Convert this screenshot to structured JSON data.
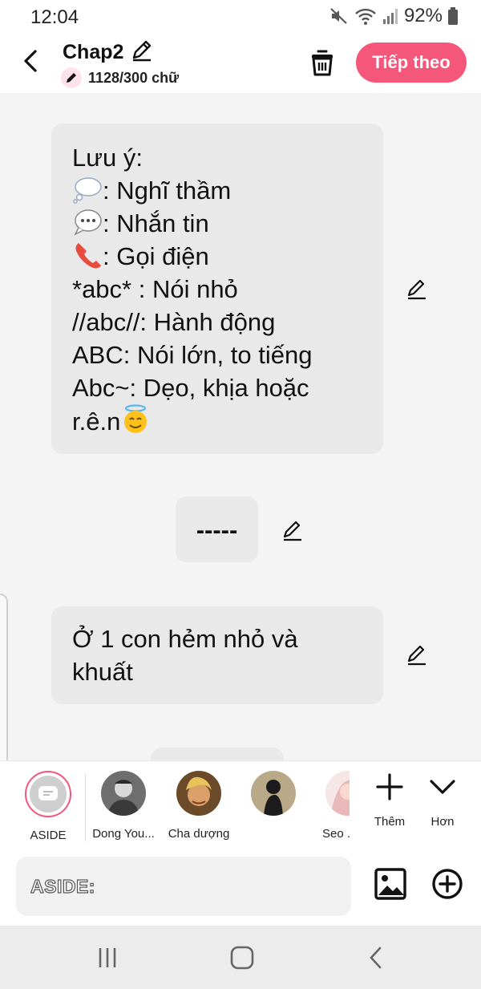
{
  "status_bar": {
    "time": "12:04",
    "battery": "92%",
    "icons": [
      "mute-icon",
      "wifi-icon",
      "signal-icon",
      "battery-icon"
    ]
  },
  "header": {
    "chapter_title": "Chap2",
    "word_count": "1128/300 chữ",
    "next_button": "Tiếp theo",
    "accent_color": "#f4577a"
  },
  "messages": {
    "note": {
      "lines": [
        {
          "text": "Lưu ý:"
        },
        {
          "icon": "thought-bubble-icon",
          "text": ": Nghĩ thầm"
        },
        {
          "icon": "speech-bubble-icon",
          "text": ": Nhắn tin"
        },
        {
          "icon": "telephone-icon",
          "text": ": Gọi điện"
        },
        {
          "text": "*abc* : Nói nhỏ"
        },
        {
          "text": "//abc//: Hành động"
        },
        {
          "text": "ABC: Nói lớn, to tiếng"
        },
        {
          "text": "Abc~: Dẹo, khịa hoặc"
        },
        {
          "text": "r.ê.n",
          "icon_after": "smiling-halo-face-icon"
        }
      ]
    },
    "divider": "-----",
    "scene": "Ở 1 con hẻm nhỏ và khuất"
  },
  "characters": [
    {
      "name": "ASIDE",
      "selected": true
    },
    {
      "name": "Dong You..."
    },
    {
      "name": "Cha dượng"
    },
    {
      "name": ""
    },
    {
      "name": "Seo ."
    }
  ],
  "tools": {
    "more_label": "Thêm",
    "collapse_label": "Hơn"
  },
  "input": {
    "label": "ASIDE:",
    "value": ""
  }
}
